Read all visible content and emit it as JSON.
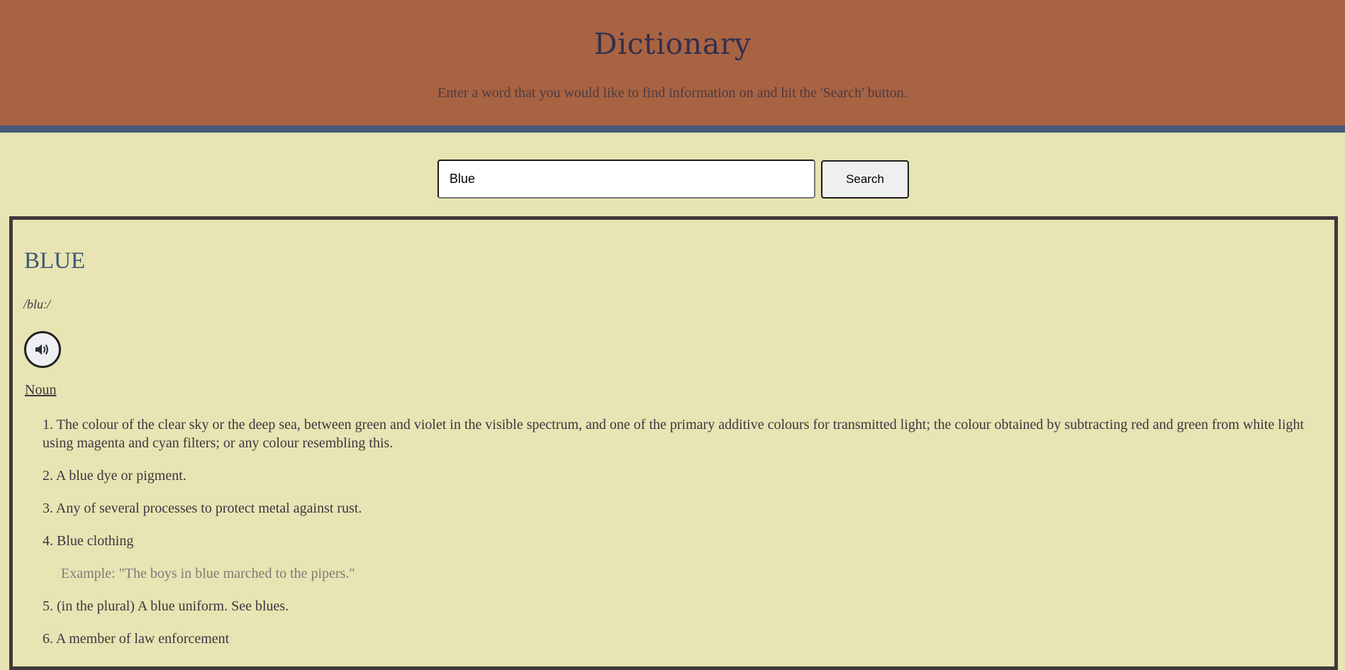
{
  "header": {
    "title": "Dictionary",
    "subtitle": "Enter a word that you would like to find information on and hit the 'Search' button."
  },
  "search": {
    "value": "Blue",
    "button_label": "Search"
  },
  "result": {
    "word": "BLUE",
    "phonetic": "/bluː/",
    "audio_icon": "speaker-icon",
    "part_of_speech": "Noun",
    "definitions": [
      {
        "text": "1. The colour of the clear sky or the deep sea, between green and violet in the visible spectrum, and one of the primary additive colours for transmitted light; the colour obtained by subtracting red and green from white light using magenta and cyan filters; or any colour resembling this."
      },
      {
        "text": "2. A blue dye or pigment."
      },
      {
        "text": "3. Any of several processes to protect metal against rust."
      },
      {
        "text": "4. Blue clothing",
        "example": "Example: \"The boys in blue marched to the pipers.\""
      },
      {
        "text": "5. (in the plural) A blue uniform. See blues."
      },
      {
        "text": "6. A member of law enforcement"
      }
    ]
  },
  "colors": {
    "header_bg": "#a86343",
    "header_rule": "#455a79",
    "page_bg": "#e8e4b3",
    "word_title": "#3c5873",
    "box_border": "#3f383b"
  }
}
